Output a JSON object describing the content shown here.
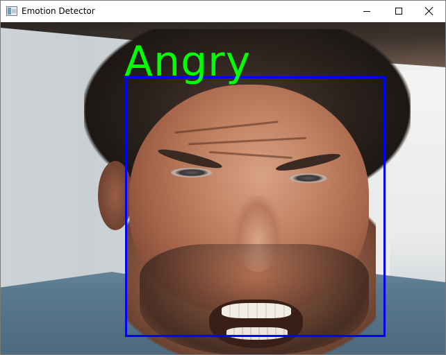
{
  "window": {
    "title": "Emotion Detector",
    "icons": {
      "app": "app-window-icon",
      "minimize": "minimize-icon",
      "maximize": "maximize-icon",
      "close": "close-icon"
    }
  },
  "feed": {
    "detection": {
      "emotion_label": "Angry",
      "label_color": "#00ff00",
      "box_color": "#0000ff"
    }
  }
}
